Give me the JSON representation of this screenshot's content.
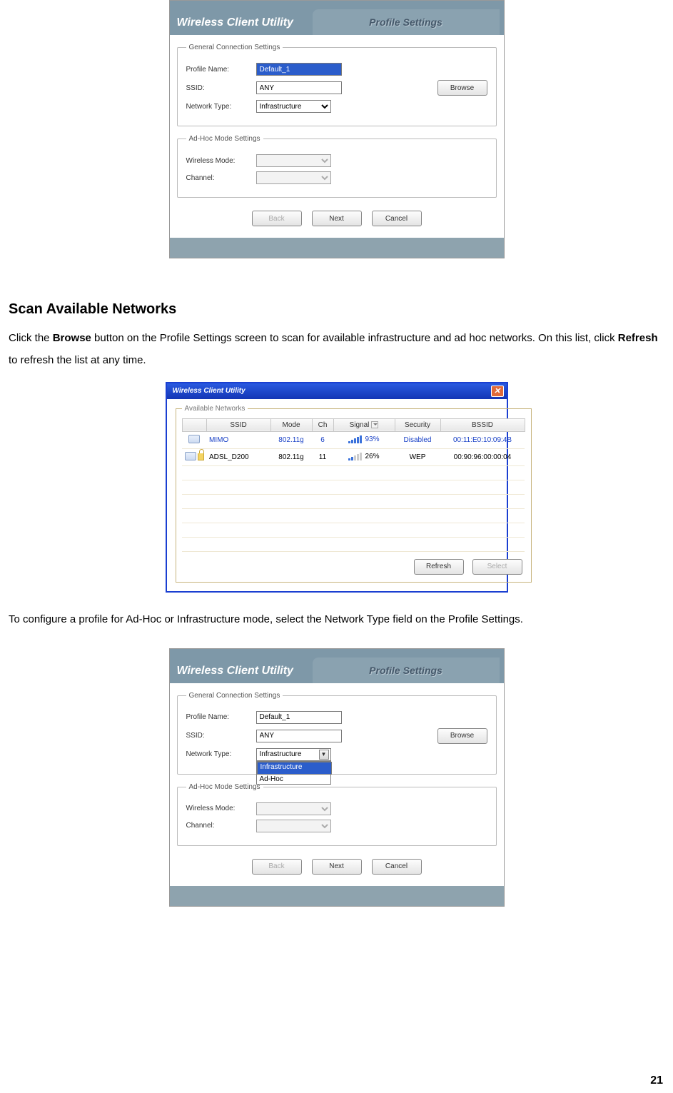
{
  "page_number": "21",
  "section_heading": "Scan Available Networks",
  "para1_a": "Click the ",
  "para1_b": "Browse",
  "para1_c": " button on the Profile Settings screen to scan for available infrastructure and ad hoc networks. On this list, click ",
  "para1_d": "Refresh",
  "para1_e": " to refresh the list at any time.",
  "para2": "To configure a profile for Ad-Hoc or Infrastructure mode, select the Network Type field on the Profile Settings.",
  "dlg": {
    "app_title": "Wireless Client Utility",
    "tab": "Profile Settings",
    "group_general": "General Connection Settings",
    "group_adhoc": "Ad-Hoc Mode Settings",
    "lbl_profile": "Profile Name:",
    "lbl_ssid": "SSID:",
    "lbl_nettype": "Network Type:",
    "lbl_wmode": "Wireless Mode:",
    "lbl_channel": "Channel:",
    "val_profile": "Default_1",
    "val_ssid": "ANY",
    "val_nettype": "Infrastructure",
    "nettype_options": [
      "Infrastructure",
      "Ad-Hoc"
    ],
    "btn_browse": "Browse",
    "btn_back": "Back",
    "btn_next": "Next",
    "btn_cancel": "Cancel"
  },
  "scan": {
    "title": "Wireless Client Utility",
    "group": "Available Networks",
    "headers": {
      "ssid": "SSID",
      "mode": "Mode",
      "ch": "Ch",
      "signal": "Signal",
      "security": "Security",
      "bssid": "BSSID"
    },
    "rows": [
      {
        "ssid": "MIMO",
        "mode": "802.11g",
        "ch": "6",
        "signal": "93%",
        "bars": 5,
        "security": "Disabled",
        "bssid": "00:11:E0:10:09:4B",
        "locked": false
      },
      {
        "ssid": "ADSL_D200",
        "mode": "802.11g",
        "ch": "11",
        "signal": "26%",
        "bars": 2,
        "security": "WEP",
        "bssid": "00:90:96:00:00:04",
        "locked": true
      }
    ],
    "empty_rows": 6,
    "btn_refresh": "Refresh",
    "btn_select": "Select"
  }
}
